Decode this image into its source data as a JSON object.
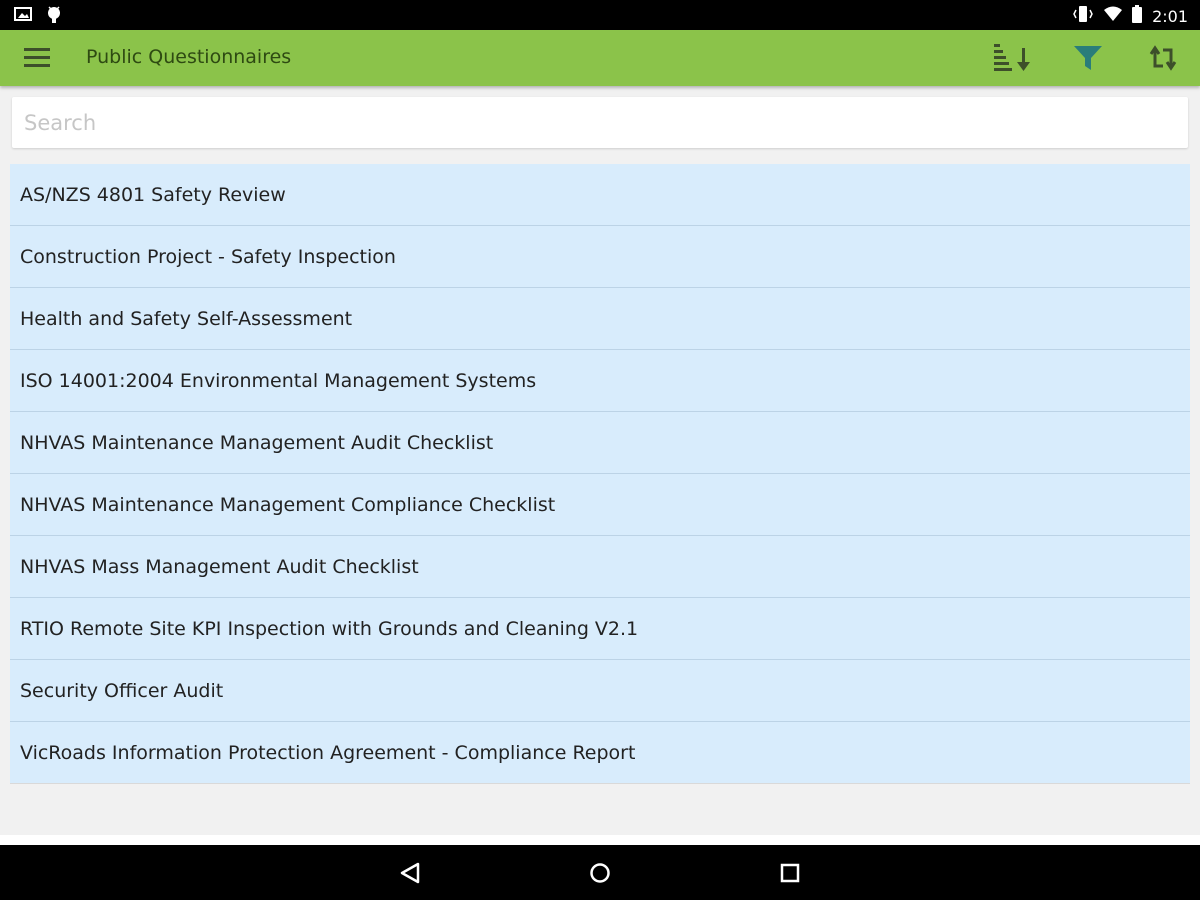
{
  "status_bar": {
    "time": "2:01",
    "left_icons": [
      "image-icon",
      "android-icon"
    ],
    "right_icons": [
      "vibrate-icon",
      "wifi-icon",
      "battery-icon"
    ]
  },
  "app_bar": {
    "title": "Public Questionnaires",
    "color": "#8bc34a",
    "actions": [
      "sort-icon",
      "filter-icon",
      "sync-icon"
    ]
  },
  "search": {
    "placeholder": "Search",
    "value": ""
  },
  "questionnaires": [
    "AS/NZS 4801 Safety Review",
    "Construction Project - Safety Inspection",
    "Health and Safety Self-Assessment",
    "ISO 14001:2004 Environmental Management Systems",
    "NHVAS Maintenance Management Audit Checklist",
    "NHVAS Maintenance Management Compliance Checklist",
    "NHVAS Mass Management Audit Checklist",
    "RTIO Remote Site KPI Inspection with Grounds and Cleaning V2.1",
    "Security Officer Audit",
    "VicRoads Information Protection Agreement - Compliance Report"
  ],
  "nav_bar": {
    "buttons": [
      "back-icon",
      "home-icon",
      "recents-icon"
    ]
  }
}
